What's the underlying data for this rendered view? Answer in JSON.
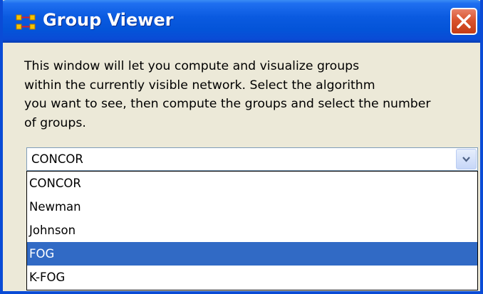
{
  "window": {
    "title": "Group Viewer",
    "app_icon": "network-nodes-icon",
    "close_icon": "close-icon",
    "colors": {
      "titlebar": "#0a5ae0",
      "close_button": "#d9542e",
      "selection": "#316ac5",
      "panel": "#ece9d8"
    }
  },
  "description": {
    "lines": [
      "This window will let you compute and visualize groups",
      "within the currently visible network. Select the algorithm",
      "you want to see, then compute the groups and select the number",
      "of groups."
    ]
  },
  "algorithm_select": {
    "selected_value": "CONCOR",
    "arrow_icon": "chevron-down-icon",
    "options": [
      "CONCOR",
      "Newman",
      "Johnson",
      "FOG",
      "K-FOG"
    ],
    "highlighted_option": "FOG"
  }
}
